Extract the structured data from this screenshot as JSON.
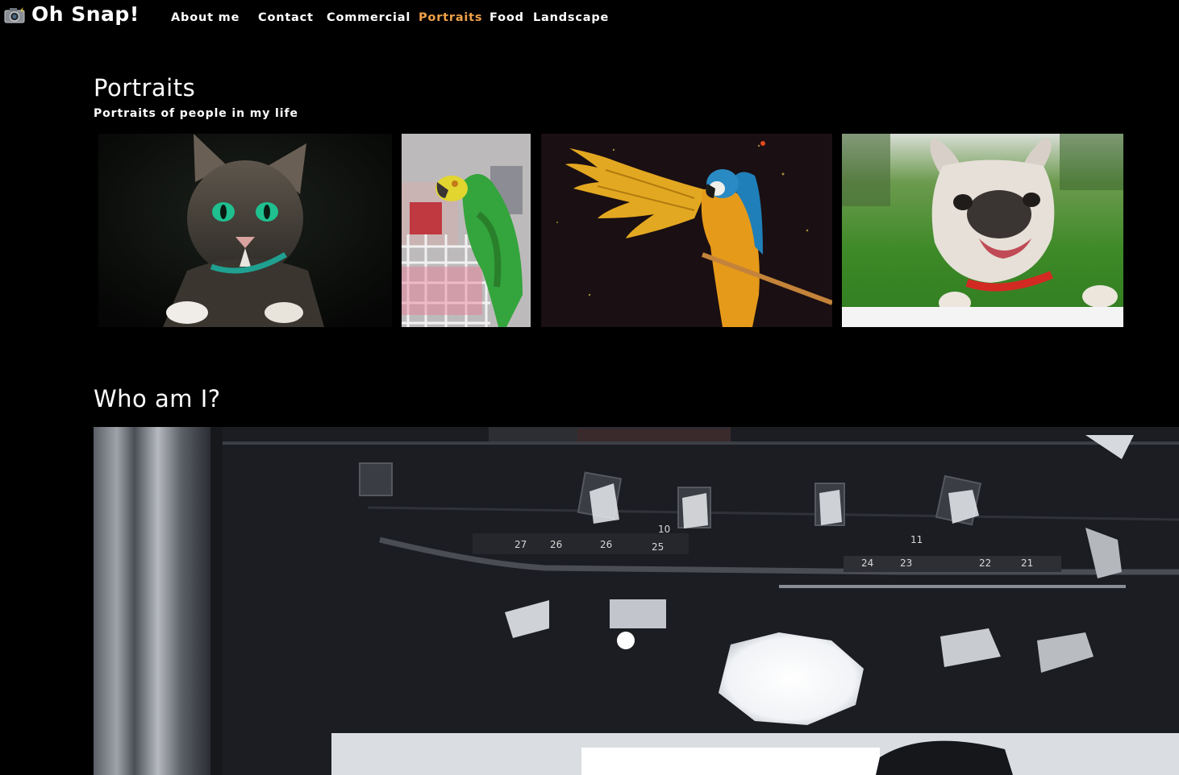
{
  "header": {
    "logo_icon": "camera-icon",
    "brand": "Oh Snap!",
    "nav": [
      {
        "label": "About me",
        "active": false
      },
      {
        "label": "Contact",
        "active": false
      },
      {
        "label": "Commercial",
        "active": false
      },
      {
        "label": "Portraits",
        "active": true
      },
      {
        "label": "Food",
        "active": false
      },
      {
        "label": "Landscape",
        "active": false
      }
    ],
    "active_color": "#f0a048"
  },
  "portraits": {
    "title": "Portraits",
    "subtitle": "Portraits of people in my life",
    "photos": [
      {
        "subject": "tabby cat with green eyes"
      },
      {
        "subject": "green parrot on a cage"
      },
      {
        "subject": "blue-and-gold macaw with spread wing"
      },
      {
        "subject": "french bulldog on grass"
      }
    ]
  },
  "about": {
    "title": "Who am I?",
    "hero_subject": "photo studio lighting rig",
    "rig_numbers": [
      "27",
      "26",
      "26",
      "10",
      "25",
      "11",
      "24",
      "23",
      "22",
      "21"
    ]
  }
}
